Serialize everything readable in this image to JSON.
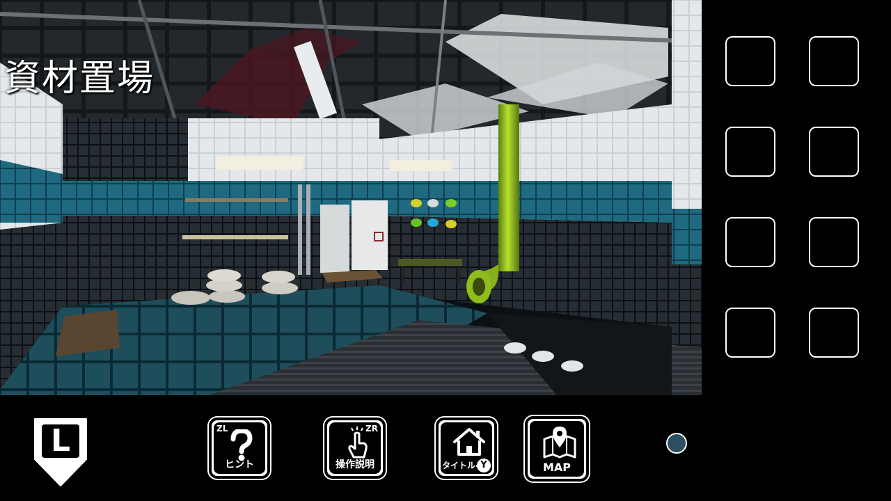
{
  "location": {
    "title": "資材置場"
  },
  "inventory": {
    "slot_count": 8
  },
  "controls": {
    "hint": {
      "label": "ヒント",
      "shortcut": "ZL",
      "icon": "question-mark-icon"
    },
    "instructions": {
      "label": "操作説明",
      "shortcut": "ZR",
      "icon": "tap-hand-icon"
    },
    "title_screen": {
      "label": "タイトルへ",
      "shortcut": "Y",
      "icon": "home-icon"
    },
    "map": {
      "label": "MAP",
      "icon": "map-pin-icon"
    },
    "back": {
      "label": "L",
      "icon": "down-arrow-tag-icon"
    }
  },
  "colors": {
    "tile_teal": "#1f6a80",
    "tile_white": "#d8dde0",
    "tile_dark": "#1a2026",
    "pipe_green": "#9ccc1a",
    "status_dot": "#2d4f64"
  }
}
